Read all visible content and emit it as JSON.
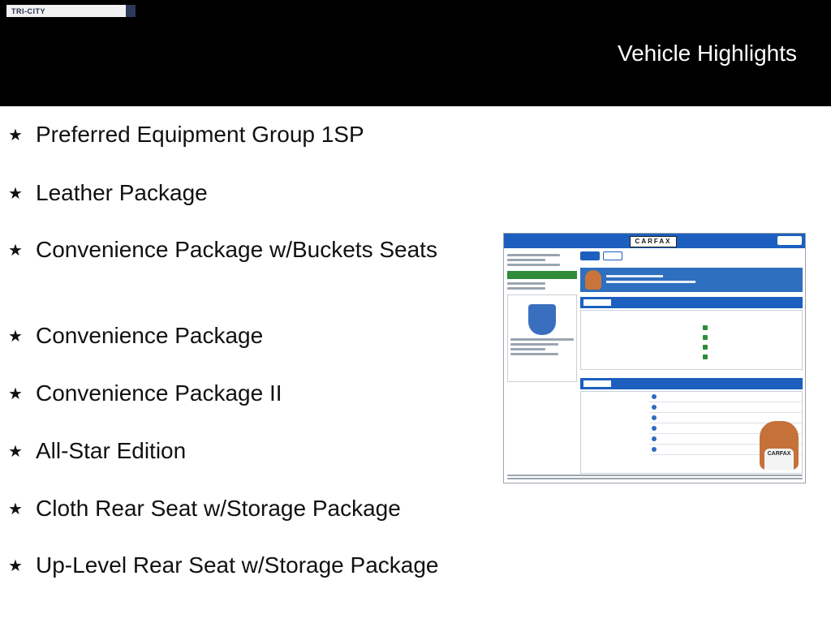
{
  "header": {
    "logo_text": "TRI-CITY",
    "title": "Vehicle Highlights"
  },
  "highlights": [
    "Preferred Equipment Group 1SP",
    "Leather Package",
    "Convenience Package w/Buckets Seats",
    "Convenience Package",
    "Convenience Package II",
    "All-Star Edition",
    "Cloth Rear Seat w/Storage Package",
    "Up-Level Rear Seat w/Storage Package"
  ],
  "bullet_symbol": "★",
  "carfax": {
    "logo_text": "CARFAX",
    "shirt_text": "CARFAX",
    "brand_color": "#1c5fbf",
    "accent_color": "#2e8b3a"
  }
}
